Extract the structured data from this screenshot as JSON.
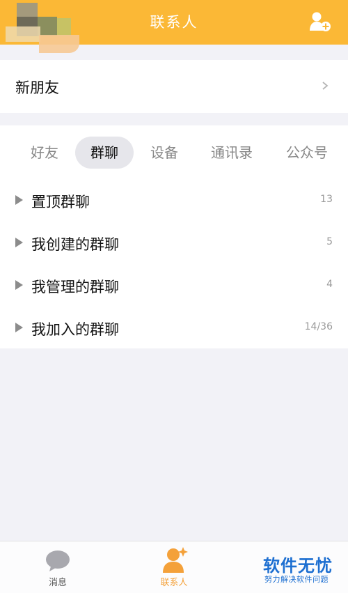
{
  "header": {
    "title": "联系人",
    "add_icon": "add-contact-icon",
    "accent_color": "#fbb836"
  },
  "new_friends": {
    "label": "新朋友",
    "chevron_icon": "chevron-right-icon"
  },
  "tabs": [
    {
      "label": "好友",
      "active": false
    },
    {
      "label": "群聊",
      "active": true
    },
    {
      "label": "设备",
      "active": false
    },
    {
      "label": "通讯录",
      "active": false
    },
    {
      "label": "公众号",
      "active": false
    }
  ],
  "groups": [
    {
      "name": "置顶群聊",
      "count": "13"
    },
    {
      "name": "我创建的群聊",
      "count": "5"
    },
    {
      "name": "我管理的群聊",
      "count": "4"
    },
    {
      "name": "我加入的群聊",
      "count": "14/36"
    }
  ],
  "bottom_nav": [
    {
      "label": "消息",
      "icon": "message-bubble-icon",
      "active": false
    },
    {
      "label": "联系人",
      "icon": "contacts-icon",
      "active": true
    }
  ],
  "watermark": {
    "title": "软件无忧",
    "subtitle": "努力解决软件问题"
  }
}
